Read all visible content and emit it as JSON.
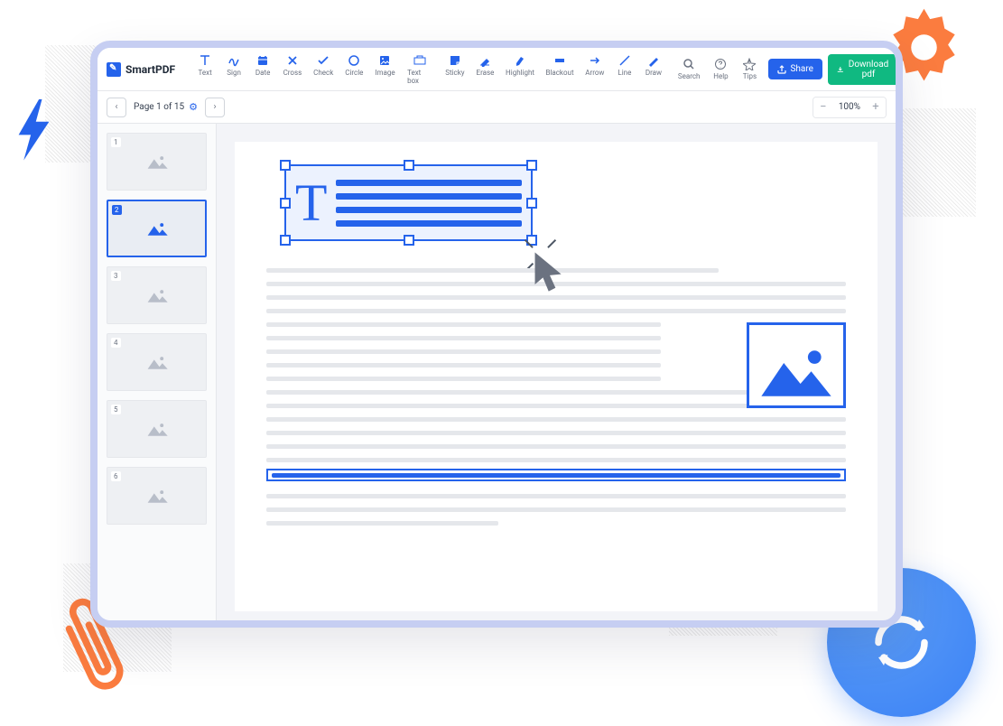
{
  "app_name": "SmartPDF",
  "tools": [
    {
      "id": "text",
      "label": "Text"
    },
    {
      "id": "sign",
      "label": "Sign"
    },
    {
      "id": "date",
      "label": "Date"
    },
    {
      "id": "cross",
      "label": "Cross"
    },
    {
      "id": "check",
      "label": "Check"
    },
    {
      "id": "circle",
      "label": "Circle"
    },
    {
      "id": "image",
      "label": "Image"
    },
    {
      "id": "textbox",
      "label": "Text box"
    },
    {
      "id": "sticky",
      "label": "Sticky"
    },
    {
      "id": "erase",
      "label": "Erase"
    },
    {
      "id": "highlight",
      "label": "Highlight"
    },
    {
      "id": "blackout",
      "label": "Blackout"
    },
    {
      "id": "arrow",
      "label": "Arrow"
    },
    {
      "id": "line",
      "label": "Line"
    },
    {
      "id": "draw",
      "label": "Draw"
    }
  ],
  "utils": [
    {
      "id": "search",
      "label": "Search"
    },
    {
      "id": "help",
      "label": "Help"
    },
    {
      "id": "tips",
      "label": "Tips"
    }
  ],
  "share_label": "Share",
  "download_label": "Download pdf",
  "page_info": "Page 1 of 15",
  "zoom_value": "100%",
  "thumbnails": [
    1,
    2,
    3,
    4,
    5,
    6
  ],
  "selected_thumb": 2,
  "colors": {
    "primary": "#2563eb",
    "success": "#10b981",
    "accent": "#fb7c3f"
  }
}
